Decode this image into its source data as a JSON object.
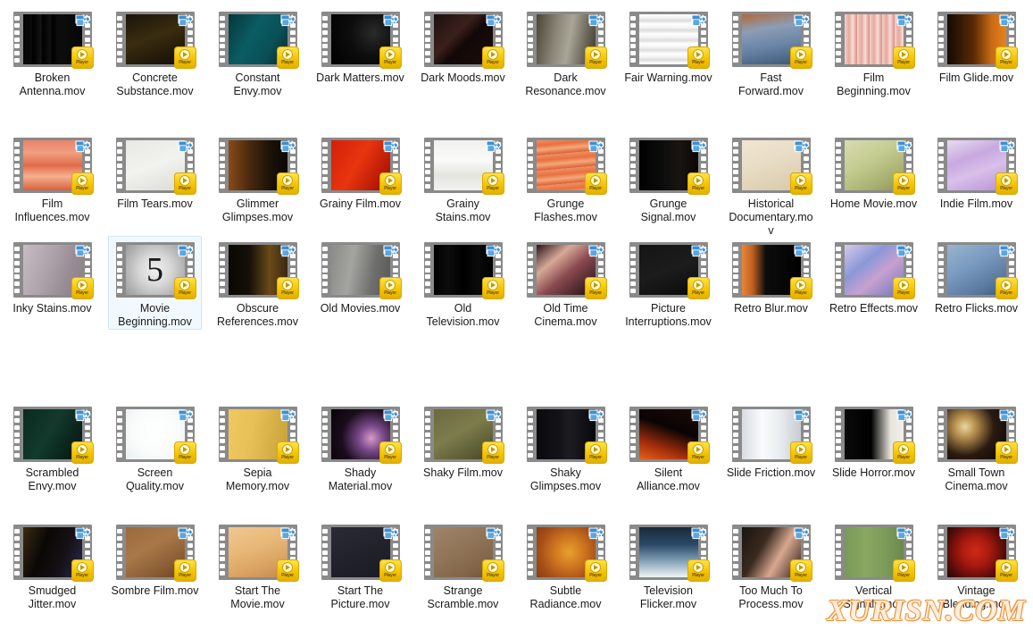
{
  "view": {
    "name": "file-explorer-thumbnail-grid",
    "background_color": "#ffffff",
    "columns": 10,
    "rows": 5,
    "total_items": 50,
    "selected_item": "Movie Beginning.mov"
  },
  "badges": {
    "shortcut_label": "shortcut-arrow",
    "player_label": "Player",
    "player_color": "#f5c400",
    "shortcut_color": "#3a8fd6"
  },
  "selection": {
    "fill_color": "#f2f9fe",
    "border_color": "#cce6f7"
  },
  "watermark": {
    "text": "XURISN.COM",
    "color": "#f08a2a"
  },
  "files": [
    {
      "name": "Broken Antenna.mov",
      "row": 0,
      "col": 0,
      "selected": false,
      "thumb": "linear-gradient(90deg,#050505 0%,#0a0a0a 14%,#000 16%,#141414 30%,#000 33%,#111 46%,#000 49%,#0d0d0d 62%,#060606 100%)"
    },
    {
      "name": "Concrete Substance.mov",
      "row": 0,
      "col": 1,
      "selected": false,
      "thumb": "linear-gradient(160deg,#1a1408 0%,#3a2c10 45%,#241b0a 75%,#120d05 100%)"
    },
    {
      "name": "Constant Envy.mov",
      "row": 0,
      "col": 2,
      "selected": false,
      "thumb": "linear-gradient(120deg,#04373c 0%,#0b5c63 40%,#0a4f56 70%,#05282c 100%)"
    },
    {
      "name": "Dark Matters.mov",
      "row": 0,
      "col": 3,
      "selected": false,
      "thumb": "radial-gradient(circle at 72% 38%,#2a2a2a 0%,#0d0d0d 45%,#000 100%)"
    },
    {
      "name": "Dark Moods.mov",
      "row": 0,
      "col": 4,
      "selected": false,
      "thumb": "linear-gradient(135deg,#1d0f0e 0%,#3b201c 38%,#120807 55%,#1a0d0b 100%)"
    },
    {
      "name": "Dark Resonance.mov",
      "row": 0,
      "col": 5,
      "selected": false,
      "thumb": "linear-gradient(100deg,#4a4638 0%,#8d8879 35%,#a9a597 55%,#6b6658 80%,#3b3830 100%)"
    },
    {
      "name": "Fair Warning.mov",
      "row": 0,
      "col": 6,
      "selected": false,
      "thumb": "repeating-linear-gradient(180deg,#ffffff 0px,#f2f2f2 4px,#dcdcdc 7px,#ffffff 11px)"
    },
    {
      "name": "Fast Forward.mov",
      "row": 0,
      "col": 7,
      "selected": false,
      "thumb": "linear-gradient(170deg,#b06a3a 0%,#8d9db5 30%,#6b86a8 60%,#3d5876 100%)"
    },
    {
      "name": "Film Beginning.mov",
      "row": 0,
      "col": 8,
      "selected": false,
      "thumb": "repeating-linear-gradient(90deg,#f3d2cc 0px,#e8a79b 5px,#f5ded8 9px,#d98e86 14px)"
    },
    {
      "name": "Film Glide.mov",
      "row": 0,
      "col": 9,
      "selected": false,
      "thumb": "linear-gradient(90deg,#140a02 0%,#5a2a06 45%,#c96a14 75%,#e8821c 100%)"
    },
    {
      "name": "Film Influences.mov",
      "row": 1,
      "col": 0,
      "selected": false,
      "thumb": "linear-gradient(180deg,#e8826a 0%,#f0a080 25%,#e06a4a 50%,#f5b090 72%,#d8603c 100%)"
    },
    {
      "name": "Film Tears.mov",
      "row": 1,
      "col": 1,
      "selected": false,
      "thumb": "linear-gradient(160deg,#e8e8e4 0%,#f2f2ee 50%,#dcdcd6 100%)"
    },
    {
      "name": "Glimmer Glimpses.mov",
      "row": 1,
      "col": 2,
      "selected": false,
      "thumb": "linear-gradient(90deg,#8a4a18 0%,#4a2a0e 35%,#1c1208 70%,#0a0704 100%)"
    },
    {
      "name": "Grainy Film.mov",
      "row": 1,
      "col": 3,
      "selected": false,
      "thumb": "linear-gradient(120deg,#d41f08 0%,#e8350f 45%,#b81a06 80%,#8a1204 100%)"
    },
    {
      "name": "Grainy Stains.mov",
      "row": 1,
      "col": 4,
      "selected": false,
      "thumb": "linear-gradient(180deg,#f0f0ee 0%,#fafaf8 40%,#e4e4e0 70%,#f2f2f0 100%)"
    },
    {
      "name": "Grunge Flashes.mov",
      "row": 1,
      "col": 5,
      "selected": false,
      "thumb": "repeating-linear-gradient(175deg,#f09060 0px,#e87040 6px,#f5a878 11px,#d86038 17px)"
    },
    {
      "name": "Grunge Signal.mov",
      "row": 1,
      "col": 6,
      "selected": false,
      "thumb": "linear-gradient(90deg,#000 0%,#0d0d0d 40%,#1a1410 70%,#080604 100%)"
    },
    {
      "name": "Historical Documentary.mov",
      "row": 1,
      "col": 7,
      "selected": false,
      "thumb": "linear-gradient(160deg,#f0e6d2 0%,#e8dcc4 45%,#d8c8a8 100%)"
    },
    {
      "name": "Home Movie.mov",
      "row": 1,
      "col": 8,
      "selected": false,
      "thumb": "linear-gradient(150deg,#d8dcb0 0%,#c4cc90 40%,#a8b070 75%,#8a9058 100%)"
    },
    {
      "name": "Indie Film.mov",
      "row": 1,
      "col": 9,
      "selected": false,
      "thumb": "linear-gradient(160deg,#e8dcf0 0%,#c8a8e0 35%,#d8c0ea 60%,#b890d8 100%)"
    },
    {
      "name": "Inky Stains.mov",
      "row": 2,
      "col": 0,
      "selected": false,
      "thumb": "linear-gradient(110deg,#c8bcc4 0%,#b0a4ac 40%,#9a8e96 70%,#8a7e86 100%)"
    },
    {
      "name": "Movie Beginning.mov",
      "row": 2,
      "col": 1,
      "selected": true,
      "thumb": "radial-gradient(circle at 50% 50%,#f0f0f0 0%,#d8d8d8 40%,#b8b8b8 70%,#9a9a9a 100%)",
      "overlay_text": "5"
    },
    {
      "name": "Obscure References.mov",
      "row": 2,
      "col": 2,
      "selected": false,
      "thumb": "linear-gradient(90deg,#0a0805 0%,#141008 35%,#6a4a18 70%,#3a2810 100%)"
    },
    {
      "name": "Old Movies.mov",
      "row": 2,
      "col": 3,
      "selected": false,
      "thumb": "linear-gradient(100deg,#8a8a88 0%,#a4a4a0 35%,#6e6e6c 70%,#585856 100%)"
    },
    {
      "name": "Old Television.mov",
      "row": 2,
      "col": 4,
      "selected": false,
      "thumb": "linear-gradient(90deg,#000 0%,#0c0c0c 25%,#000 50%,#0a0a0a 75%,#000 100%)"
    },
    {
      "name": "Old Time Cinema.mov",
      "row": 2,
      "col": 5,
      "selected": false,
      "thumb": "linear-gradient(140deg,#2a1418 0%,#d8a898 30%,#8a4a50 55%,#1a0c10 100%)"
    },
    {
      "name": "Picture Interruptions.mov",
      "row": 2,
      "col": 6,
      "selected": false,
      "thumb": "linear-gradient(160deg,#141414 0%,#1c1c1c 50%,#0a0a0a 100%)"
    },
    {
      "name": "Retro Blur.mov",
      "row": 2,
      "col": 7,
      "selected": false,
      "thumb": "linear-gradient(90deg,#e8873a 0%,#c06020 18%,#0d0d0d 40%,#000 100%)"
    },
    {
      "name": "Retro Effects.mov",
      "row": 2,
      "col": 8,
      "selected": false,
      "thumb": "linear-gradient(140deg,#d8c8e8 0%,#8a98d8 35%,#c8a0d0 60%,#6a78b8 100%)"
    },
    {
      "name": "Retro Flicks.mov",
      "row": 2,
      "col": 9,
      "selected": false,
      "thumb": "linear-gradient(150deg,#9ab4d0 0%,#7a9ac0 40%,#5a7aa0 75%,#3a5a80 100%)"
    },
    {
      "name": "Scrambled Envy.mov",
      "row": 3,
      "col": 0,
      "selected": false,
      "thumb": "linear-gradient(120deg,#0a2a20 0%,#123a2c 45%,#0a241c 75%,#041410 100%)"
    },
    {
      "name": "Screen Quality.mov",
      "row": 3,
      "col": 1,
      "selected": false,
      "thumb": "radial-gradient(circle at 50% 45%,#ffffff 0%,#fafcfc 55%,#eaf0f0 100%)"
    },
    {
      "name": "Sepia Memory.mov",
      "row": 3,
      "col": 2,
      "selected": false,
      "thumb": "linear-gradient(100deg,#f0c860 0%,#e8c058 40%,#d8b048 70%,#c8a038 100%)"
    },
    {
      "name": "Shady Material.mov",
      "row": 3,
      "col": 3,
      "selected": false,
      "thumb": "radial-gradient(circle at 68% 58%,#d89ac8 0%,#7a4a8a 25%,#1a0c1c 60%,#080408 100%)"
    },
    {
      "name": "Shaky Film.mov",
      "row": 3,
      "col": 4,
      "selected": false,
      "thumb": "linear-gradient(150deg,#6a6a40 0%,#7c7c4c 45%,#5a5a34 80%,#44442a 100%)"
    },
    {
      "name": "Shaky Glimpses.mov",
      "row": 3,
      "col": 5,
      "selected": false,
      "thumb": "linear-gradient(90deg,#0a0a0e 0%,#141418 40%,#1c1c22 55%,#08080c 100%)"
    },
    {
      "name": "Silent Alliance.mov",
      "row": 3,
      "col": 6,
      "selected": false,
      "thumb": "linear-gradient(200deg,#1a0a06 0%,#0a0404 40%,#a8300c 75%,#e8601a 100%)"
    },
    {
      "name": "Slide Friction.mov",
      "row": 3,
      "col": 7,
      "selected": false,
      "thumb": "linear-gradient(90deg,#d8dce0 0%,#fafcfe 35%,#e8ecf0 65%,#c8ccd0 100%)"
    },
    {
      "name": "Slide Horror.mov",
      "row": 3,
      "col": 8,
      "selected": false,
      "thumb": "linear-gradient(90deg,#0a0a0a 0%,#000 45%,#e8e4dc 78%,#f2f0ea 100%)"
    },
    {
      "name": "Small Town Cinema.mov",
      "row": 3,
      "col": 9,
      "selected": false,
      "thumb": "radial-gradient(circle at 30% 35%,#e8d8a0 0%,#b89050 20%,#2a1a10 55%,#0a0604 100%)"
    },
    {
      "name": "Smudged Jitter.mov",
      "row": 4,
      "col": 0,
      "selected": false,
      "thumb": "linear-gradient(110deg,#3a2a10 0%,#0a0806 35%,#141014 65%,#2a2a50 100%)"
    },
    {
      "name": "Sombre Film.mov",
      "row": 4,
      "col": 1,
      "selected": false,
      "thumb": "linear-gradient(150deg,#9a6a40 0%,#a87848 40%,#8a5c34 75%,#6a4424 100%)"
    },
    {
      "name": "Start The Movie.mov",
      "row": 4,
      "col": 2,
      "selected": false,
      "thumb": "linear-gradient(160deg,#f0c890 0%,#e8b878 40%,#d8a060 75%,#c08a4c 100%)"
    },
    {
      "name": "Start The Picture.mov",
      "row": 4,
      "col": 3,
      "selected": false,
      "thumb": "linear-gradient(160deg,#2a2a34 0%,#22222c 50%,#1a1a24 100%)"
    },
    {
      "name": "Strange Scramble.mov",
      "row": 4,
      "col": 4,
      "selected": false,
      "thumb": "linear-gradient(150deg,#a08468 0%,#907458 45%,#806448 80%,#6a5038 100%)"
    },
    {
      "name": "Subtle Radiance.mov",
      "row": 4,
      "col": 5,
      "selected": false,
      "thumb": "radial-gradient(circle at 55% 50%,#e8a030 0%,#d07820 35%,#a85018 70%,#8a3c10 100%)"
    },
    {
      "name": "Television Flicker.mov",
      "row": 4,
      "col": 6,
      "selected": false,
      "thumb": "linear-gradient(180deg,#1a2a38 0%,#2a4a68 35%,#7a9ab0 65%,#f0f4f6 100%)"
    },
    {
      "name": "Too Much To Process.mov",
      "row": 4,
      "col": 7,
      "selected": false,
      "thumb": "linear-gradient(120deg,#1a1410 0%,#3a2a20 35%,#d8a890 62%,#2a1a14 100%)"
    },
    {
      "name": "Vertical Signals.mov",
      "row": 4,
      "col": 8,
      "selected": false,
      "thumb": "linear-gradient(90deg,#7a9858 0%,#8aa862 35%,#7c9a5a 70%,#6a8a4c 100%)"
    },
    {
      "name": "Vintage Blending.mov",
      "row": 4,
      "col": 9,
      "selected": false,
      "thumb": "radial-gradient(circle at 48% 48%,#d02a18 0%,#a81a10 35%,#5a0c08 70%,#1a0404 100%)"
    }
  ]
}
